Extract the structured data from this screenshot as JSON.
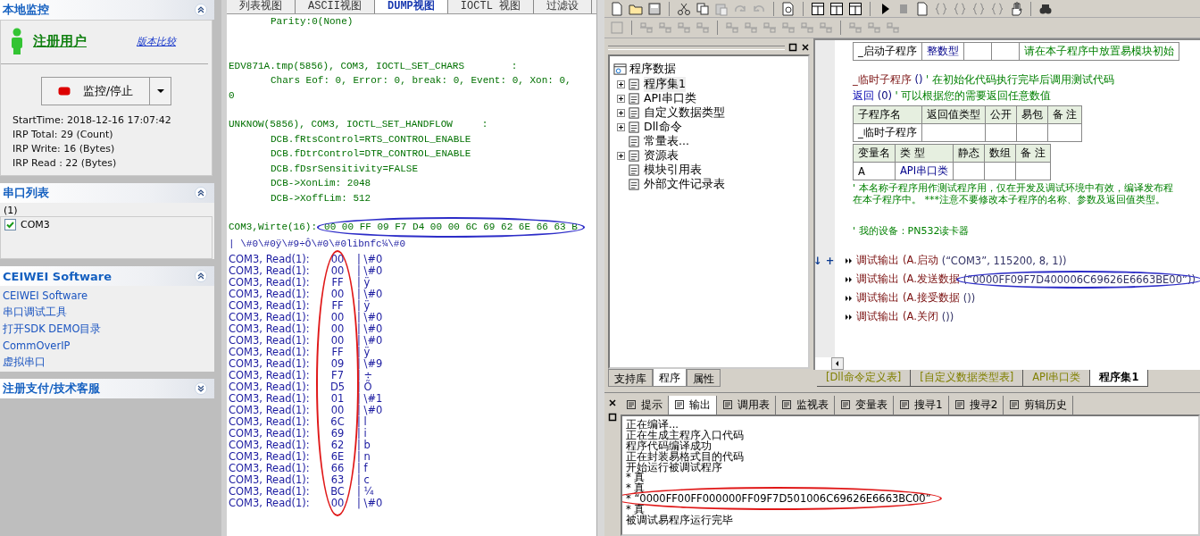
{
  "monitor_panel": {
    "title": "本地监控",
    "expanded": true,
    "user_link": "注册用户",
    "compare_link": "版本比较",
    "button": "监控/停止",
    "stats": [
      "StartTime: 2018-12-16 17:07:42",
      "IRP Total: 29 (Count)",
      "IRP Write: 16 (Bytes)",
      "IRP Read : 22 (Bytes)"
    ]
  },
  "port_panel": {
    "title": "串口列表",
    "expanded": true,
    "count": "(1)",
    "ports": [
      {
        "label": "COM3",
        "checked": true
      }
    ]
  },
  "links_panel": {
    "title": "CEIWEI Software",
    "expanded": true,
    "links": [
      "CEIWEI Software",
      "串口调试工具",
      "打开SDK DEMO目录",
      "CommOverIP",
      "虚拟串口"
    ]
  },
  "support_panel": {
    "title": "注册支付/技术客服",
    "expanded": false
  },
  "dump_tabs": [
    {
      "label": "列表视图",
      "selected": false
    },
    {
      "label": "ASCII视图",
      "selected": false
    },
    {
      "label": "DUMP视图",
      "selected": true
    },
    {
      "label": "IOCTL 视图",
      "selected": false
    },
    {
      "label": "过滤设",
      "selected": false
    }
  ],
  "dump": {
    "lines": [
      {
        "kind": "detail",
        "text": "Parity:0(None)"
      },
      {
        "kind": "header",
        "text": "EDV871A.tmp(5856), COM3, IOCTL_SET_CHARS        :"
      },
      {
        "kind": "detail",
        "text": "Chars Eof: 0, Error: 0, break: 0, Event: 0, Xon: 0,"
      },
      {
        "kind": "wrap",
        "text": "0"
      },
      {
        "kind": "header",
        "text": "UNKNOW(5856), COM3, IOCTL_SET_HANDFLOW     :"
      },
      {
        "kind": "detail",
        "text": "DCB.fRtsControl=RTS_CONTROL_ENABLE"
      },
      {
        "kind": "detail",
        "text": "DCB.fDtrControl=DTR_CONTROL_ENABLE"
      },
      {
        "kind": "detail",
        "text": "DCB.fDsrSensitivity=FALSE"
      },
      {
        "kind": "detail",
        "text": "DCB->XonLim: 2048"
      },
      {
        "kind": "detail",
        "text": "DCB->XoffLim: 512"
      }
    ],
    "write": {
      "label": "COM3,Wirte(16):",
      "hex": "00 00 FF 09 F7 D4 00 00 6C 69 62 6E 66 63 B",
      "ascii": "| \\#0\\#0ÿ\\#9÷Ô\\#0\\#0libnfc¼\\#0",
      "circled": true
    },
    "reads_circled": true,
    "reads": [
      {
        "label": "COM3, Read(1):",
        "byte": "00",
        "char": "| \\#0"
      },
      {
        "label": "COM3, Read(1):",
        "byte": "00",
        "char": "| \\#0"
      },
      {
        "label": "COM3, Read(1):",
        "byte": "FF",
        "char": "| ÿ"
      },
      {
        "label": "COM3, Read(1):",
        "byte": "00",
        "char": "| \\#0"
      },
      {
        "label": "COM3, Read(1):",
        "byte": "FF",
        "char": "| ÿ"
      },
      {
        "label": "COM3, Read(1):",
        "byte": "00",
        "char": "| \\#0"
      },
      {
        "label": "COM3, Read(1):",
        "byte": "00",
        "char": "| \\#0"
      },
      {
        "label": "COM3, Read(1):",
        "byte": "00",
        "char": "| \\#0"
      },
      {
        "label": "COM3, Read(1):",
        "byte": "FF",
        "char": "| ÿ"
      },
      {
        "label": "COM3, Read(1):",
        "byte": "09",
        "char": "| \\#9"
      },
      {
        "label": "COM3, Read(1):",
        "byte": "F7",
        "char": "| ÷"
      },
      {
        "label": "COM3, Read(1):",
        "byte": "D5",
        "char": "| Õ"
      },
      {
        "label": "COM3, Read(1):",
        "byte": "01",
        "char": "| \\#1"
      },
      {
        "label": "COM3, Read(1):",
        "byte": "00",
        "char": "| \\#0"
      },
      {
        "label": "COM3, Read(1):",
        "byte": "6C",
        "char": "| l"
      },
      {
        "label": "COM3, Read(1):",
        "byte": "69",
        "char": "| i"
      },
      {
        "label": "COM3, Read(1):",
        "byte": "62",
        "char": "| b"
      },
      {
        "label": "COM3, Read(1):",
        "byte": "6E",
        "char": "| n"
      },
      {
        "label": "COM3, Read(1):",
        "byte": "66",
        "char": "| f"
      },
      {
        "label": "COM3, Read(1):",
        "byte": "63",
        "char": "| c"
      },
      {
        "label": "COM3, Read(1):",
        "byte": "BC",
        "char": "| ¼"
      },
      {
        "label": "COM3, Read(1):",
        "byte": "00",
        "char": "| \\#0"
      }
    ]
  },
  "tree": {
    "label": "程序数据",
    "children": [
      {
        "label": "程序集1",
        "expandable": true,
        "selected": true
      },
      {
        "label": "API串口类",
        "expandable": true,
        "selected": false
      },
      {
        "label": "自定义数据类型",
        "expandable": true,
        "selected": false
      },
      {
        "label": "Dll命令",
        "expandable": true,
        "selected": false
      },
      {
        "label": "常量表...",
        "expandable": false,
        "selected": false
      },
      {
        "label": "资源表",
        "expandable": true,
        "selected": false
      },
      {
        "label": "模块引用表",
        "expandable": false,
        "selected": false
      },
      {
        "label": "外部文件记录表",
        "expandable": false,
        "selected": false
      }
    ]
  },
  "tree_tabs": [
    {
      "label": "支持库",
      "selected": false
    },
    {
      "label": "程序",
      "selected": true
    },
    {
      "label": "属性",
      "selected": false
    }
  ],
  "editor": {
    "start_row": {
      "name": "_启动子程序",
      "type": "整数型",
      "note": "请在本子程序中放置易模块初始"
    },
    "header_lines": [
      [
        {
          "kind": "name",
          "text": "_临时子程序"
        },
        {
          "kind": "paren",
          "text": " () "
        },
        {
          "kind": "comment",
          "text": "' 在初始化代码执行完毕后调用测试代码"
        }
      ],
      [
        {
          "kind": "keyword",
          "text": "返回"
        },
        {
          "kind": "paren",
          "text": " (0) "
        },
        {
          "kind": "comment",
          "text": "' 可以根据您的需要返回任意数值"
        }
      ]
    ],
    "sub_table": {
      "columns": [
        "子程序名",
        "返回值类型",
        "公开",
        "易包",
        "备 注"
      ],
      "rows": [
        {
          "name": "_临时子程序"
        }
      ]
    },
    "var_table": {
      "columns": [
        "变量名",
        "类 型",
        "静态",
        "数组",
        "备 注"
      ],
      "rows": [
        {
          "name": "A",
          "type": "API串口类"
        }
      ]
    },
    "notes": [
      "' 本名称子程序用作测试程序用，仅在开发及调试环境中有效，编译发布程",
      "在本子程序中。 ***注意不要修改本子程序的名称、参数及返回值类型。"
    ],
    "device_note": "' 我的设备：PN532读卡器",
    "calls": [
      {
        "marker": "↓ +",
        "call": "调试输出",
        "target": "(A.启动",
        "args": "(“COM3”, 115200, 8, 1))",
        "circled": false
      },
      {
        "call": "调试输出",
        "target": "(A.发送数据",
        "args": "(“0000FF09F7D400006C69626E6663BE00”))",
        "circled": true
      },
      {
        "call": "调试输出",
        "target": "(A.接受数据",
        "args": "())",
        "circled": false
      },
      {
        "call": "调试输出",
        "target": "(A.关闭",
        "args": "())",
        "circled": false
      }
    ]
  },
  "editor_tabs": [
    {
      "label": "[Dll命令定义表]",
      "selected": false
    },
    {
      "label": "[自定义数据类型表]",
      "selected": false
    },
    {
      "label": "API串口类",
      "selected": false
    },
    {
      "label": "程序集1",
      "selected": true
    }
  ],
  "output_tabs": [
    {
      "label": "提示",
      "selected": false
    },
    {
      "label": "输出",
      "selected": true
    },
    {
      "label": "调用表",
      "selected": false
    },
    {
      "label": "监视表",
      "selected": false
    },
    {
      "label": "变量表",
      "selected": false
    },
    {
      "label": "搜寻1",
      "selected": false
    },
    {
      "label": "搜寻2",
      "selected": false
    },
    {
      "label": "剪辑历史",
      "selected": false
    }
  ],
  "output_lines": [
    {
      "text": "正在编译...",
      "circled": false
    },
    {
      "text": "正在生成主程序入口代码",
      "circled": false
    },
    {
      "text": "程序代码编译成功",
      "circled": false
    },
    {
      "text": "正在封装易格式目的代码",
      "circled": false
    },
    {
      "text": "开始运行被调试程序",
      "circled": false
    },
    {
      "text": "* 真",
      "circled": false
    },
    {
      "text": "* 真",
      "circled": false
    },
    {
      "text": "* “0000FF00FF000000FF09F7D501006C69626E6663BC00”",
      "circled": true
    },
    {
      "text": "* 真",
      "circled": false
    },
    {
      "text": "被调试易程序运行完毕",
      "circled": false
    }
  ]
}
